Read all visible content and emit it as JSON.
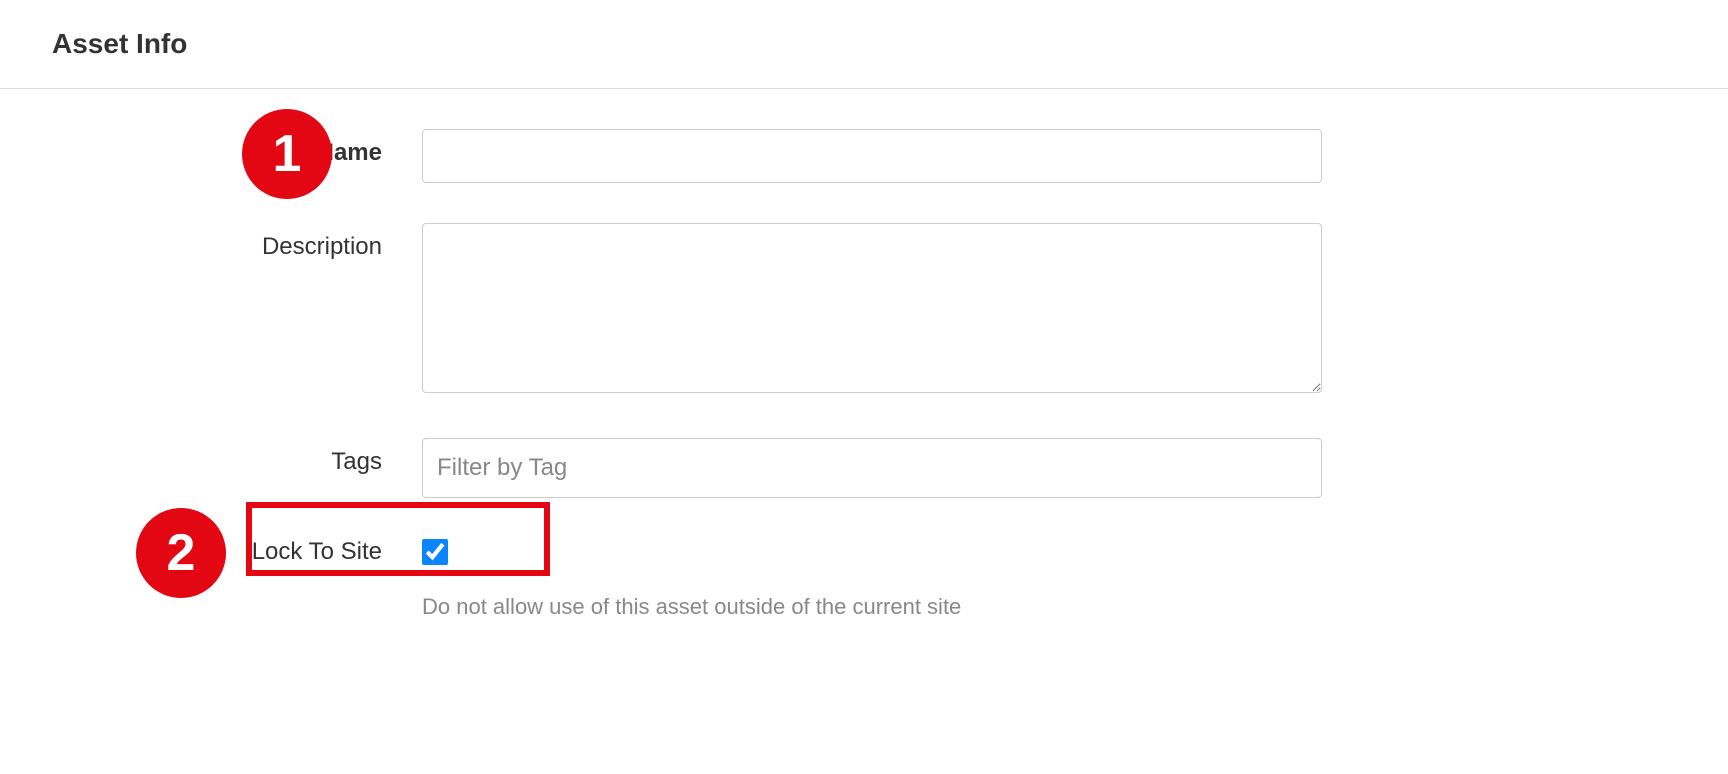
{
  "section": {
    "title": "Asset Info"
  },
  "form": {
    "name": {
      "label": "Name",
      "value": ""
    },
    "description": {
      "label": "Description",
      "value": ""
    },
    "tags": {
      "label": "Tags",
      "placeholder": "Filter by Tag",
      "value": ""
    },
    "lock_to_site": {
      "label": "Lock To Site",
      "checked": true,
      "help_text": "Do not allow use of this asset outside of the current site"
    }
  },
  "annotations": {
    "badge1": "1",
    "badge2": "2"
  }
}
